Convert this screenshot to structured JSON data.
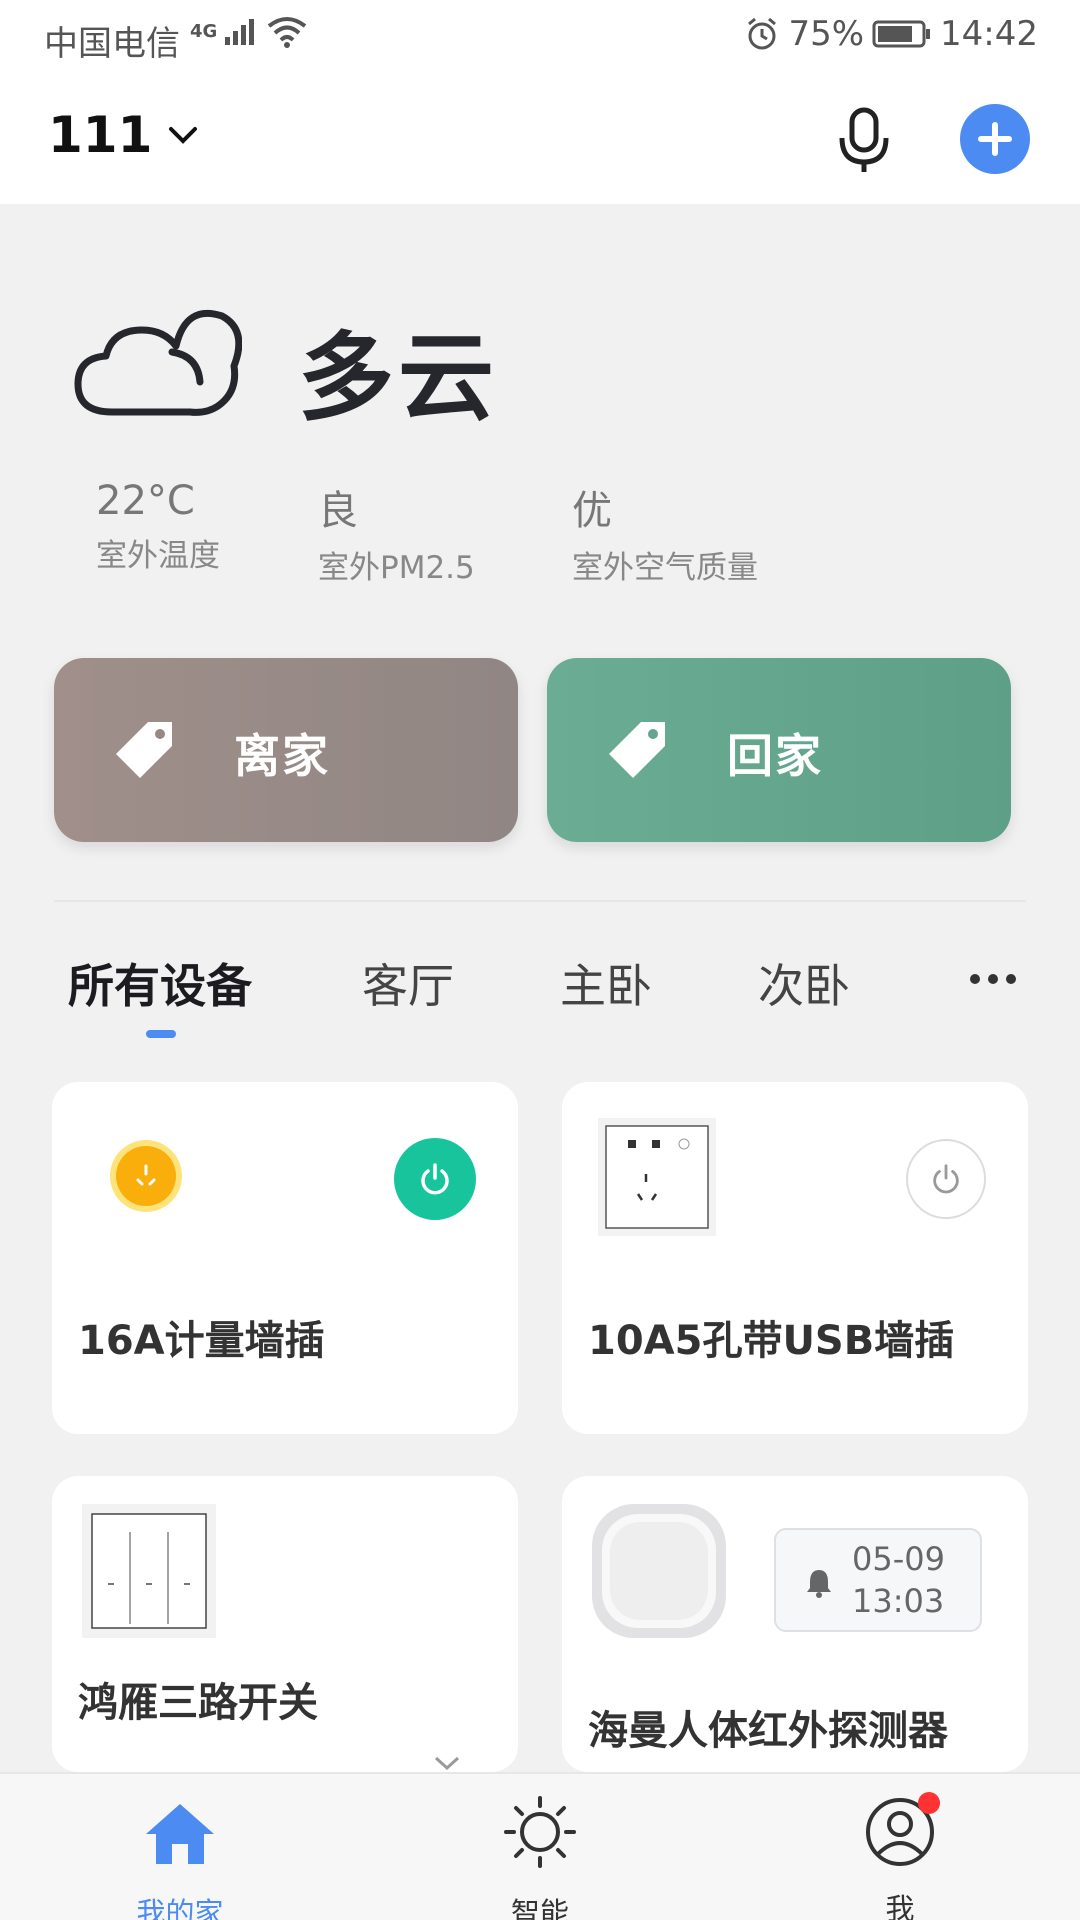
{
  "status_bar": {
    "carrier": "中国电信",
    "network": "4G",
    "battery": "75%",
    "time": "14:42"
  },
  "header": {
    "home_name": "111",
    "add_icon": "plus-circle-icon",
    "mic_icon": "microphone-icon",
    "accent_color": "#4c8cf2"
  },
  "weather": {
    "condition": "多云",
    "icon": "cloud-icon",
    "stats": [
      {
        "value": "22°C",
        "label": "室外温度"
      },
      {
        "value": "良",
        "label": "室外PM2.5"
      },
      {
        "value": "优",
        "label": "室外空气质量"
      }
    ]
  },
  "scenes": [
    {
      "label": "离家",
      "color": "#978884"
    },
    {
      "label": "回家",
      "color": "#63a68d"
    }
  ],
  "rooms": {
    "tabs": [
      "所有设备",
      "客厅",
      "主卧",
      "次卧"
    ],
    "active": "所有设备"
  },
  "devices": [
    {
      "name": "16A计量墙插",
      "power": "on"
    },
    {
      "name": "10A5孔带USB墙插",
      "power": "off"
    },
    {
      "name": "鸿雁三路开关"
    },
    {
      "name": "海曼人体红外探测器",
      "alarm_date": "05-09",
      "alarm_time": "13:03"
    }
  ],
  "tabbar": {
    "items": [
      {
        "label": "我的家",
        "icon": "home-icon",
        "active": true
      },
      {
        "label": "智能",
        "icon": "sun-icon",
        "active": false
      },
      {
        "label": "我",
        "icon": "user-icon",
        "active": false,
        "badge": true
      }
    ]
  }
}
